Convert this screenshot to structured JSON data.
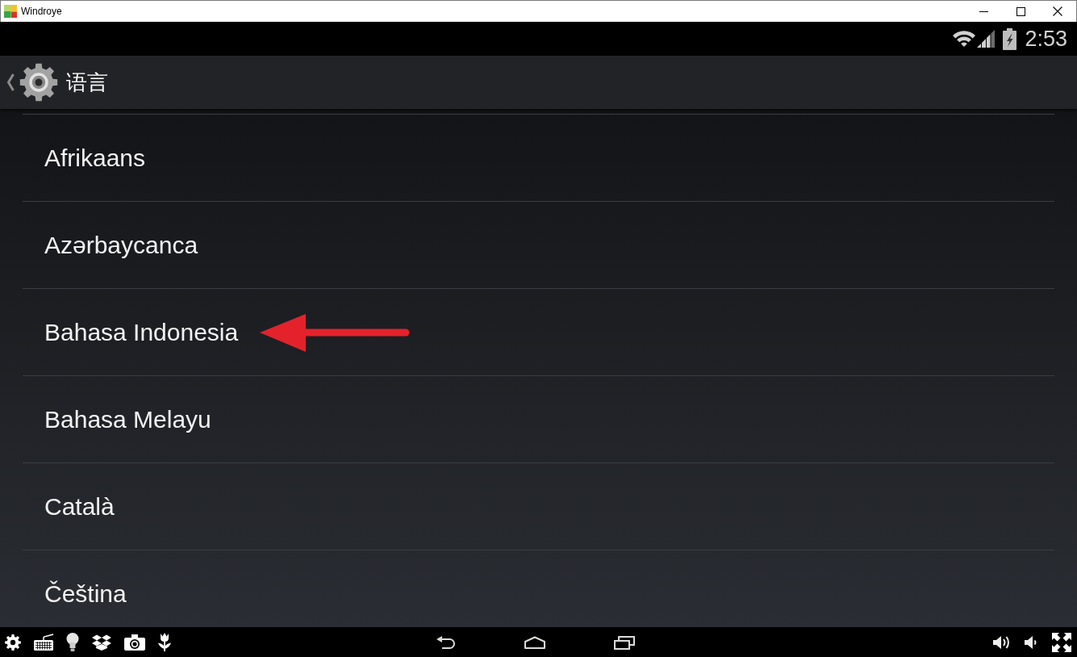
{
  "window": {
    "title": "Windroye"
  },
  "status_bar": {
    "time": "2:53"
  },
  "action_bar": {
    "title": "语言"
  },
  "languages": [
    {
      "label": "Afrikaans",
      "marked": false
    },
    {
      "label": "Azərbaycanca",
      "marked": false
    },
    {
      "label": "Bahasa Indonesia",
      "marked": true
    },
    {
      "label": "Bahasa Melayu",
      "marked": false
    },
    {
      "label": "Català",
      "marked": false
    },
    {
      "label": "Čeština",
      "marked": false
    }
  ]
}
